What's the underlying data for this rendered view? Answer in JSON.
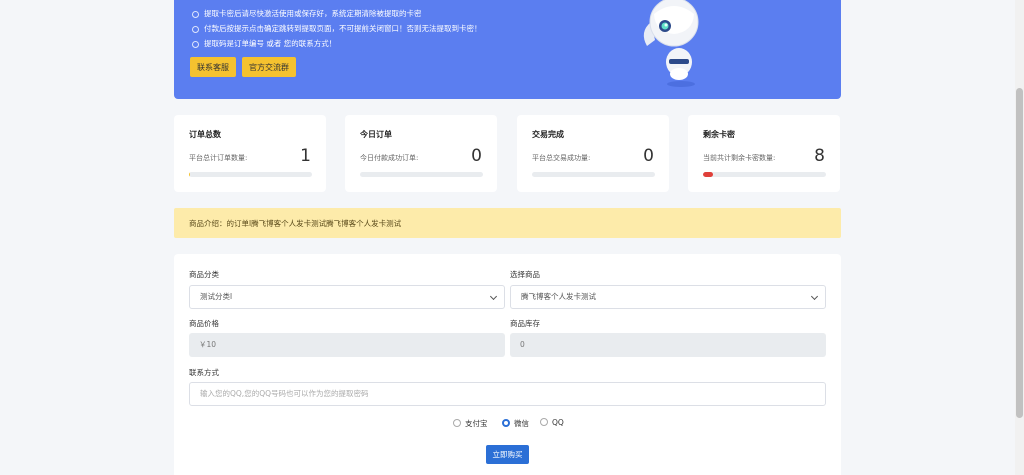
{
  "banner": {
    "tips": [
      "提取卡密后请尽快激活使用或保存好，系统定期清除被提取的卡密",
      "付款后按提示点击确定跳转到提取页面，不可提前关闭窗口！否则无法提取到卡密！",
      "提取码是订单编号 或者 您的联系方式！"
    ],
    "service_label": "联系客服",
    "group_label": "官方交流群"
  },
  "stats": [
    {
      "title": "订单总数",
      "desc": "平台总计订单数量:",
      "value": "1",
      "progress": 0.01,
      "color": "#f5c22f"
    },
    {
      "title": "今日订单",
      "desc": "今日付款成功订单:",
      "value": "0",
      "progress": 0,
      "color": "#2b6fd6"
    },
    {
      "title": "交易完成",
      "desc": "平台总交易成功量:",
      "value": "0",
      "progress": 0,
      "color": "#2b6fd6"
    },
    {
      "title": "剩余卡密",
      "desc": "当前共计剩余卡密数量:",
      "value": "8",
      "progress": 0.08,
      "color": "#e0403a"
    }
  ],
  "notice": {
    "text": "商品介绍：的订单l腾飞博客个人发卡测试腾飞博客个人发卡测试"
  },
  "form": {
    "category_label": "商品分类",
    "category_value": "测试分类l",
    "product_label": "选择商品",
    "product_value": "腾飞博客个人发卡测试",
    "price_label": "商品价格",
    "price_value": "￥10",
    "stock_label": "商品库存",
    "stock_value": "0",
    "contact_label": "联系方式",
    "contact_placeholder": "输入您的QQ,您的QQ号码也可以作为您的提取密码"
  },
  "payment": {
    "options": [
      "支付宝",
      "微信",
      "QQ"
    ],
    "selected": "微信"
  },
  "buy_label": "立即购买"
}
